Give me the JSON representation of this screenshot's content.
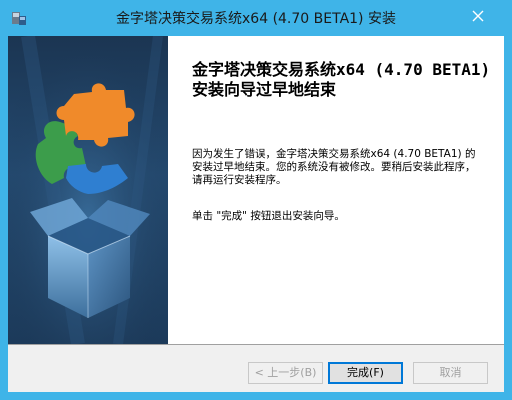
{
  "window": {
    "title": "金字塔决策交易系统x64 (4.70 BETA1) 安装"
  },
  "content": {
    "heading": "金字塔决策交易系统x64 (4.70 BETA1) 安装向导过早地结束",
    "error_message": "因为发生了错误，金字塔决策交易系统x64 (4.70 BETA1) 的安装过早地结束。您的系统没有被修改。要稍后安装此程序，请再运行安装程序。",
    "finish_hint": "单击 \"完成\" 按钮退出安装向导。"
  },
  "buttons": {
    "back": "< 上一步(B)",
    "finish": "完成(F)",
    "cancel": "取消"
  },
  "icons": {
    "app": "installer-icon",
    "close": "close-icon",
    "side_art": "puzzle-box-art"
  },
  "colors": {
    "title_bar": "#3fb4e8",
    "side_panel": "#1e3a5c",
    "footer": "#f0f0f0",
    "default_button_border": "#0078d7"
  }
}
